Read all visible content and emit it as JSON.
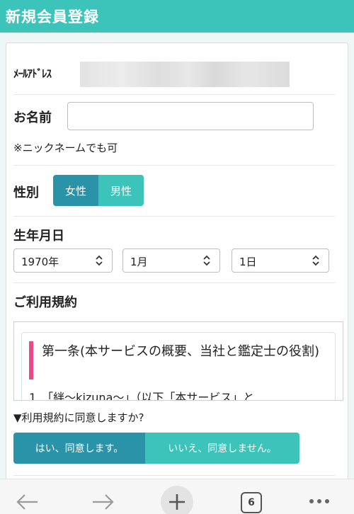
{
  "header": {
    "title": "新規会員登録"
  },
  "form": {
    "email_label": "ﾒｰﾙｱﾄﾞﾚｽ",
    "name_label": "お名前",
    "name_value": "",
    "nickname_note": "※ニックネームでも可",
    "gender": {
      "label": "性別",
      "options": [
        "女性",
        "男性"
      ],
      "selected": "女性"
    },
    "birthdate": {
      "label": "生年月日",
      "year": "1970年",
      "month": "1月",
      "day": "1日"
    },
    "terms": {
      "label": "ご利用規約",
      "heading": "第一条(本サービスの概要、当社と鑑定士の役割)",
      "item_1": "1　「絆～kizuna～」（以下「本サービス」と"
    },
    "agree": {
      "question": "▼利用規約に同意しますか?",
      "yes_label": "はい、同意します。",
      "no_label": "いいえ、同意しません。"
    }
  },
  "browser_toolbar": {
    "tab_count": "6",
    "icons": [
      "back-arrow-icon",
      "forward-arrow-icon",
      "new-tab-plus-icon",
      "tab-count",
      "more-dots-icon"
    ]
  },
  "colors": {
    "header_bg": "#3cc3ba",
    "primary_dark": "#2a93a8",
    "primary_light": "#3cc3ba",
    "terms_accent": "#e94b8a"
  }
}
